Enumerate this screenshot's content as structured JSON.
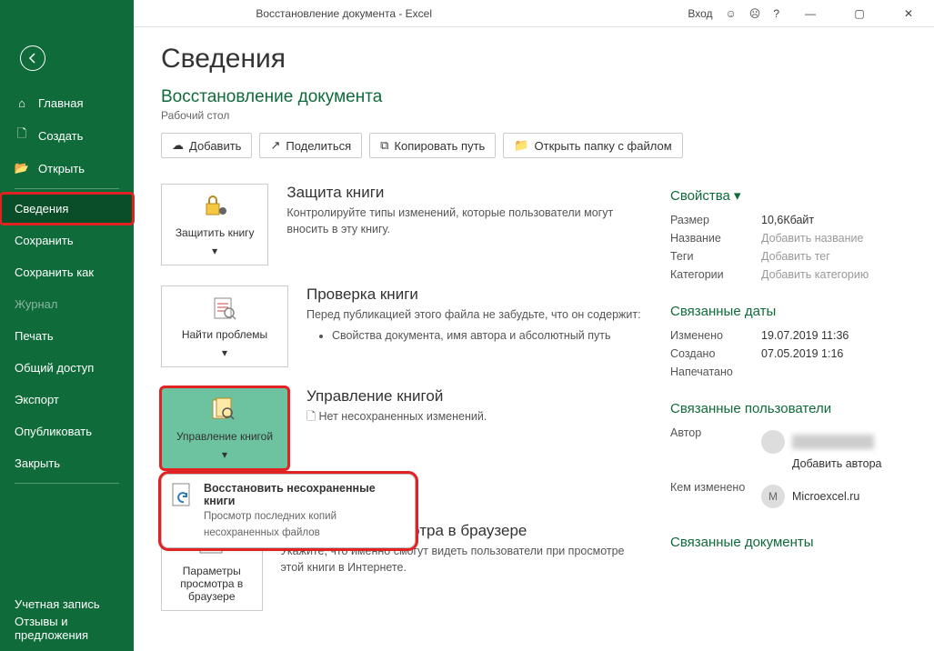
{
  "titlebar": {
    "title": "Восстановление документа - Excel",
    "signin": "Вход"
  },
  "sidebar": {
    "home": "Главная",
    "new": "Создать",
    "open": "Открыть",
    "info": "Сведения",
    "save": "Сохранить",
    "saveas": "Сохранить как",
    "history": "Журнал",
    "print": "Печать",
    "share": "Общий доступ",
    "export": "Экспорт",
    "publish": "Опубликовать",
    "close": "Закрыть",
    "account": "Учетная запись",
    "feedback": "Отзывы и предложения"
  },
  "page": {
    "title": "Сведения",
    "doc_title": "Восстановление документа",
    "doc_location": "Рабочий стол"
  },
  "toolbar": {
    "upload": "Добавить",
    "share": "Поделиться",
    "copypath": "Копировать путь",
    "openfolder": "Открыть папку с файлом"
  },
  "sections": {
    "protect": {
      "btn": "Защитить книгу",
      "title": "Защита книги",
      "desc": "Контролируйте типы изменений, которые пользователи могут вносить в эту книгу."
    },
    "inspect": {
      "btn": "Найти проблемы",
      "title": "Проверка книги",
      "desc": "Перед публикацией этого файла не забудьте, что он содержит:",
      "item": "Свойства документа, имя автора и абсолютный путь"
    },
    "manage": {
      "btn": "Управление книгой",
      "title": "Управление книгой",
      "desc": "Нет несохраненных изменений.",
      "popup_title": "Восстановить несохраненные книги",
      "popup_desc": "Просмотр последних копий несохраненных файлов"
    },
    "browser": {
      "btn": "Параметры просмотра в браузере",
      "title_suffix": "осмотра в браузере",
      "desc": "Укажите, что именно смогут видеть пользователи при просмотре этой книги в Интернете."
    }
  },
  "props": {
    "header": "Свойства",
    "size_label": "Размер",
    "size_val": "10,6Кбайт",
    "title_label": "Название",
    "title_ph": "Добавить название",
    "tags_label": "Теги",
    "tags_ph": "Добавить тег",
    "cat_label": "Категории",
    "cat_ph": "Добавить категорию",
    "dates_header": "Связанные даты",
    "modified_label": "Изменено",
    "modified_val": "19.07.2019 11:36",
    "created_label": "Создано",
    "created_val": "07.05.2019 1:16",
    "printed_label": "Напечатано",
    "users_header": "Связанные пользователи",
    "author_label": "Автор",
    "add_author": "Добавить автора",
    "lastmod_label": "Кем изменено",
    "lastmod_val": "Microexcel.ru",
    "docs_header": "Связанные документы"
  }
}
